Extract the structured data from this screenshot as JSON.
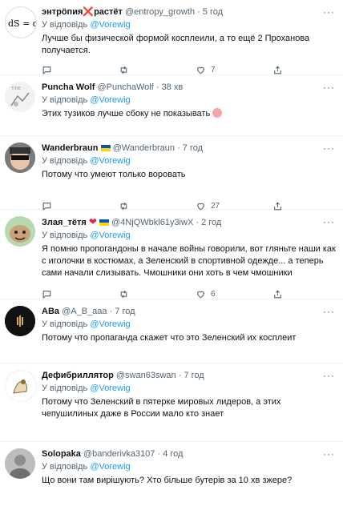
{
  "reply_prefix": "У відповідь",
  "tweets": [
    {
      "name": "энтрöпия",
      "name_emoji": "❌",
      "name_suffix": "растёт",
      "handle": "@entropy_growth",
      "time": "5 год",
      "reply_to": "@Vorewig",
      "text": "Лучше бы физической формой косплеили, а то ещё 2 Проханова получается.",
      "likes": "7",
      "avatar_text": "dS = dQ/T"
    },
    {
      "name": "Puncha Wolf",
      "handle": "@PunchaWolf",
      "time": "38 хв",
      "reply_to": "@Vorewig",
      "text": "Этих тузиков лучше сбоку не показывать",
      "likes": ""
    },
    {
      "name": "Wanderbraun",
      "handle": "@Wanderbraun",
      "time": "7 год",
      "reply_to": "@Vorewig",
      "text": "Потому что умеют только воровать",
      "likes": "27"
    },
    {
      "name": "Злая_тётя",
      "handle": "@4NjQWbkl61y3iwX",
      "time": "2 год",
      "reply_to": "@Vorewig",
      "text": "Я помню пропогандоны в начале войны говорили, вот гляньте наши как с иголочки в костюмах, а Зеленский в спортивной одежде... а теперь сами начали слизывать. Чмошники они хоть в чем чмошники",
      "likes": "6"
    },
    {
      "name": "АВа",
      "handle": "@A_B_aaa",
      "time": "7 год",
      "reply_to": "@Vorewig",
      "text": "Потому что пропаганда скажет что это Зеленский их косплеит",
      "likes": ""
    },
    {
      "name": "Дефибриллятор",
      "handle": "@swan63swan",
      "time": "7 год",
      "reply_to": "@Vorewig",
      "text": "Потому что Зеленский в пятерке мировых лидеров, а этих чепушилиных даже в России мало кто знает",
      "likes": ""
    },
    {
      "name": "Solopaka",
      "handle": "@banderivka3107",
      "time": "4 год",
      "reply_to": "@Vorewig",
      "text": "Що вони там вирішують? Хто більше бутерів за 10 хв зжере?",
      "likes": ""
    }
  ],
  "colors": {
    "accent": "#1d9bf0",
    "muted": "#536471",
    "text": "#0f1419",
    "divider": "#eff3f4"
  }
}
